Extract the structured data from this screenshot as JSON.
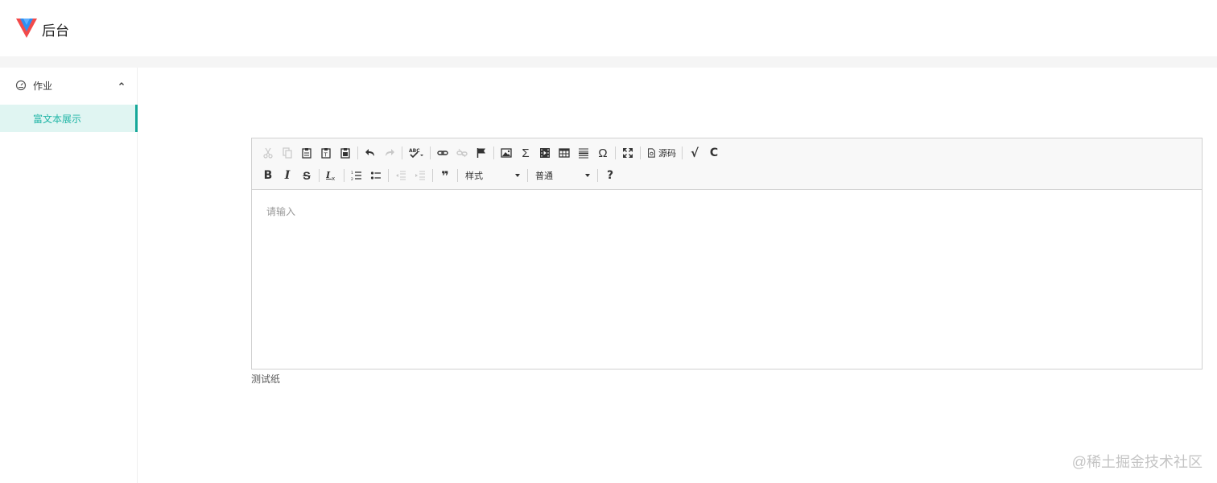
{
  "header": {
    "brand": "后台",
    "colors": {
      "logo_blue": "#2e8ff2",
      "logo_red": "#f24a4a"
    }
  },
  "sidebar": {
    "group": {
      "label": "作业",
      "icon": "dashboard-icon",
      "expanded": true
    },
    "items": [
      {
        "label": "富文本展示",
        "active": true
      }
    ],
    "colors": {
      "active_bg": "#e0f5f2",
      "active_text": "#1fb5a6",
      "active_bar": "#17a89a"
    }
  },
  "editor": {
    "toolbar": {
      "row1": [
        {
          "icon": "cut-icon",
          "enabled": false
        },
        {
          "icon": "copy-icon",
          "enabled": false
        },
        {
          "icon": "paste-icon",
          "enabled": true
        },
        {
          "icon": "paste-text-icon",
          "enabled": true
        },
        {
          "icon": "paste-word-icon",
          "enabled": true
        },
        {
          "icon": "undo-icon",
          "enabled": true
        },
        {
          "icon": "redo-icon",
          "enabled": false
        },
        {
          "icon": "spellcheck-icon",
          "enabled": true
        },
        {
          "icon": "link-icon",
          "enabled": true
        },
        {
          "icon": "unlink-icon",
          "enabled": false
        },
        {
          "icon": "anchor-flag-icon",
          "enabled": true
        },
        {
          "icon": "image-icon",
          "enabled": true
        },
        {
          "icon": "sigma-icon",
          "enabled": true
        },
        {
          "icon": "video-icon",
          "enabled": true
        },
        {
          "icon": "table-icon",
          "enabled": true
        },
        {
          "icon": "horizontal-rule-icon",
          "enabled": true
        },
        {
          "icon": "special-char-icon",
          "enabled": true
        },
        {
          "icon": "maximize-icon",
          "enabled": true
        },
        {
          "icon": "source-icon",
          "enabled": true
        },
        {
          "icon": "math-icon",
          "enabled": true
        },
        {
          "icon": "c-plugin-icon",
          "enabled": true
        }
      ],
      "source_label": "源码",
      "sigma_glyph": "Σ",
      "omega_glyph": "Ω",
      "bold": "B",
      "italic": "I",
      "strike": "S",
      "quote_glyph": "❞",
      "help_glyph": "?",
      "math_glyph": "√",
      "c_glyph": "C",
      "styles_combo": "样式",
      "format_combo": "普通"
    },
    "placeholder": "请输入"
  },
  "caption": "测试纸",
  "watermark": "@稀土掘金技术社区"
}
